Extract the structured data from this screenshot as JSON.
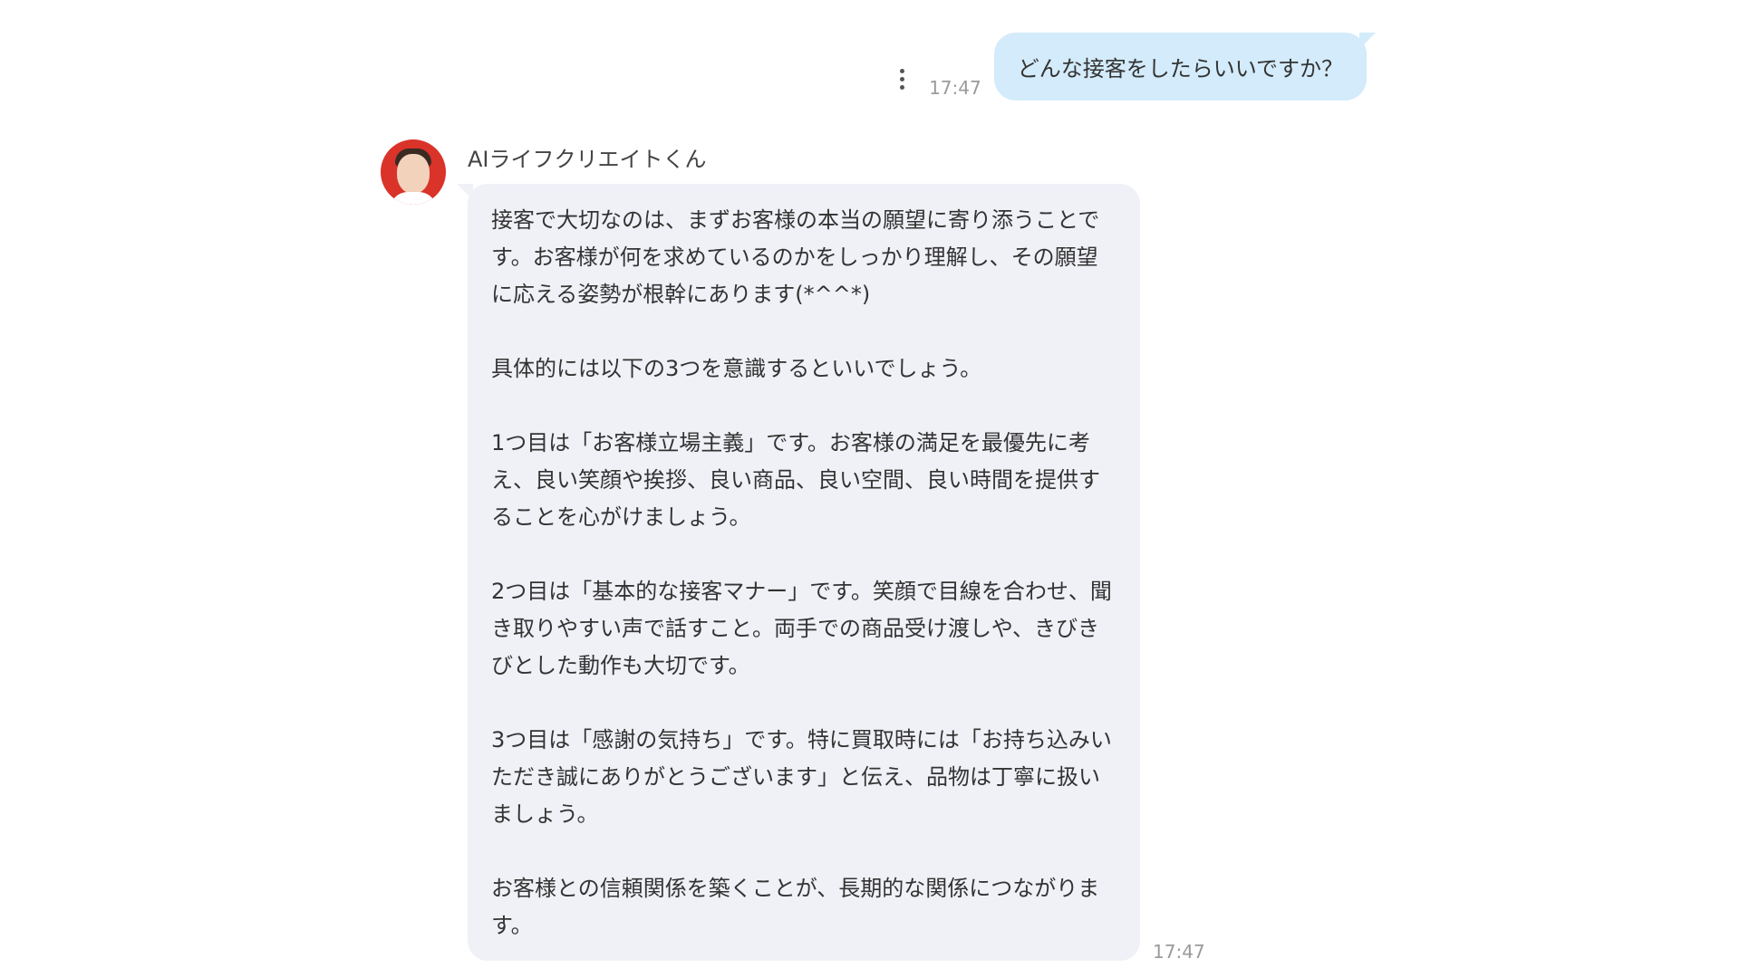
{
  "outgoing": {
    "time": "17:47",
    "text": "どんな接客をしたらいいですか？"
  },
  "incoming": {
    "sender": "AIライフクリエイトくん",
    "time": "17:47",
    "paragraphs": [
      "接客で大切なのは、まずお客様の本当の願望に寄り添うことです。お客様が何を求めているのかをしっかり理解し、その願望に応える姿勢が根幹にあります(*^^*)",
      "具体的には以下の3つを意識するといいでしょう。",
      "1つ目は「お客様立場主義」です。お客様の満足を最優先に考え、良い笑顔や挨拶、良い商品、良い空間、良い時間を提供することを心がけましょう。",
      "2つ目は「基本的な接客マナー」です。笑顔で目線を合わせ、聞き取りやすい声で話すこと。両手での商品受け渡しや、きびきびとした動作も大切です。",
      "3つ目は「感謝の気持ち」です。特に買取時には「お持ち込みいただき誠にありがとうございます」と伝え、品物は丁寧に扱いましょう。",
      "お客様との信頼関係を築くことが、長期的な関係につながります。"
    ]
  },
  "icons": {
    "more": "more-vertical-icon",
    "avatar": "bot-avatar"
  },
  "colors": {
    "outgoing_bubble": "#d3ebfa",
    "incoming_bubble": "#f0f1f7",
    "timestamp": "#9a9a9a"
  }
}
